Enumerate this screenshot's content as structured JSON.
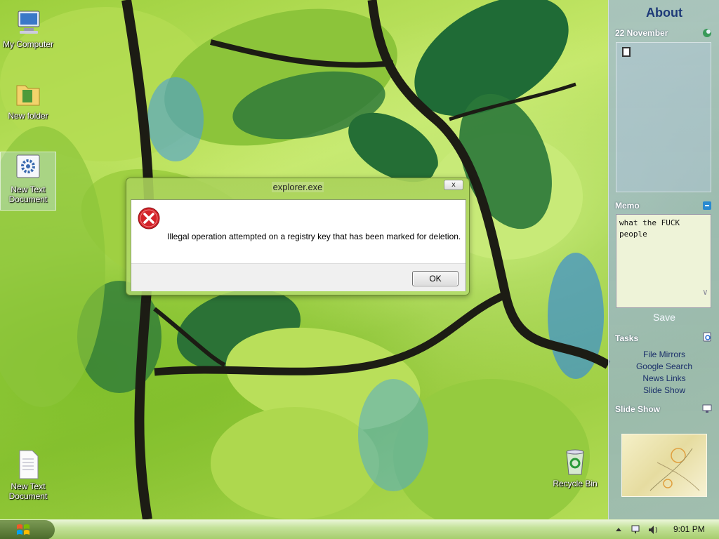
{
  "desktop": {
    "icons": [
      {
        "label": "My Computer"
      },
      {
        "label": "New folder"
      },
      {
        "label": "New Text Document"
      },
      {
        "label": "New Text Document"
      },
      {
        "label": "Recycle Bin"
      }
    ]
  },
  "sidebar": {
    "title": "About",
    "date": "22 November",
    "memo": {
      "heading": "Memo",
      "text": "what the FUCK people",
      "save_label": "Save"
    },
    "tasks": {
      "heading": "Tasks",
      "items": [
        "File Mirrors",
        "Google Search",
        "News Links",
        "Slide Show"
      ]
    },
    "slideshow": {
      "heading": "Slide Show"
    }
  },
  "dialog": {
    "title": "explorer.exe",
    "close_glyph": "x",
    "message": "Illegal operation attempted on a registry key that has been marked for deletion.",
    "ok_label": "OK",
    "icon": "error-icon"
  },
  "taskbar": {
    "clock": "9:01 PM",
    "tray_icons": [
      "show-hidden-icon",
      "network-icon",
      "volume-icon"
    ]
  },
  "colors": {
    "error_red": "#d3232a",
    "sidebar_title": "#1e3a78",
    "task_link": "#1b2f6a"
  }
}
